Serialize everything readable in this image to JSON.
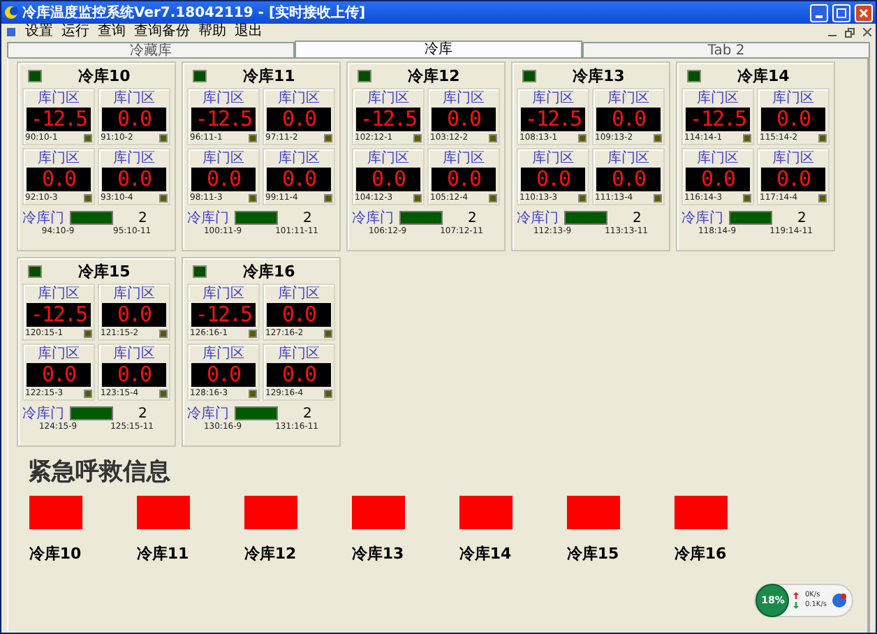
{
  "window": {
    "title": "冷库温度监控系统Ver7.18042119 - [实时接收上传]"
  },
  "menu": [
    "设置",
    "运行",
    "查询",
    "查询备份",
    "帮助",
    "退出"
  ],
  "tabs": [
    {
      "label": "冷藏库",
      "selected": false
    },
    {
      "label": "冷库",
      "selected": true
    },
    {
      "label": "Tab 2",
      "selected": false
    }
  ],
  "cards": [
    {
      "name": "冷库10",
      "zones": [
        {
          "label": "库门区",
          "value": "-12.5",
          "code": "90:10-1"
        },
        {
          "label": "库门区",
          "value": "0.0",
          "code": "91:10-2"
        },
        {
          "label": "库门区",
          "value": "0.0",
          "code": "92:10-3"
        },
        {
          "label": "库门区",
          "value": "0.0",
          "code": "93:10-4"
        }
      ],
      "door": {
        "label": "冷库门",
        "count": "2",
        "codes": [
          "94:10-9",
          "95:10-11"
        ]
      }
    },
    {
      "name": "冷库11",
      "zones": [
        {
          "label": "库门区",
          "value": "-12.5",
          "code": "96:11-1"
        },
        {
          "label": "库门区",
          "value": "0.0",
          "code": "97:11-2"
        },
        {
          "label": "库门区",
          "value": "0.0",
          "code": "98:11-3"
        },
        {
          "label": "库门区",
          "value": "0.0",
          "code": "99:11-4"
        }
      ],
      "door": {
        "label": "冷库门",
        "count": "2",
        "codes": [
          "100:11-9",
          "101:11-11"
        ]
      }
    },
    {
      "name": "冷库12",
      "zones": [
        {
          "label": "库门区",
          "value": "-12.5",
          "code": "102:12-1"
        },
        {
          "label": "库门区",
          "value": "0.0",
          "code": "103:12-2"
        },
        {
          "label": "库门区",
          "value": "0.0",
          "code": "104:12-3"
        },
        {
          "label": "库门区",
          "value": "0.0",
          "code": "105:12-4"
        }
      ],
      "door": {
        "label": "冷库门",
        "count": "2",
        "codes": [
          "106:12-9",
          "107:12-11"
        ]
      }
    },
    {
      "name": "冷库13",
      "zones": [
        {
          "label": "库门区",
          "value": "-12.5",
          "code": "108:13-1"
        },
        {
          "label": "库门区",
          "value": "0.0",
          "code": "109:13-2"
        },
        {
          "label": "库门区",
          "value": "0.0",
          "code": "110:13-3"
        },
        {
          "label": "库门区",
          "value": "0.0",
          "code": "111:13-4"
        }
      ],
      "door": {
        "label": "冷库门",
        "count": "2",
        "codes": [
          "112:13-9",
          "113:13-11"
        ]
      }
    },
    {
      "name": "冷库14",
      "zones": [
        {
          "label": "库门区",
          "value": "-12.5",
          "code": "114:14-1"
        },
        {
          "label": "库门区",
          "value": "0.0",
          "code": "115:14-2"
        },
        {
          "label": "库门区",
          "value": "0.0",
          "code": "116:14-3"
        },
        {
          "label": "库门区",
          "value": "0.0",
          "code": "117:14-4"
        }
      ],
      "door": {
        "label": "冷库门",
        "count": "2",
        "codes": [
          "118:14-9",
          "119:14-11"
        ]
      }
    },
    {
      "name": "冷库15",
      "zones": [
        {
          "label": "库门区",
          "value": "-12.5",
          "code": "120:15-1"
        },
        {
          "label": "库门区",
          "value": "0.0",
          "code": "121:15-2"
        },
        {
          "label": "库门区",
          "value": "0.0",
          "code": "122:15-3"
        },
        {
          "label": "库门区",
          "value": "0.0",
          "code": "123:15-4"
        }
      ],
      "door": {
        "label": "冷库门",
        "count": "2",
        "codes": [
          "124:15-9",
          "125:15-11"
        ]
      }
    },
    {
      "name": "冷库16",
      "zones": [
        {
          "label": "库门区",
          "value": "-12.5",
          "code": "126:16-1"
        },
        {
          "label": "库门区",
          "value": "0.0",
          "code": "127:16-2"
        },
        {
          "label": "库门区",
          "value": "0.0",
          "code": "128:16-3"
        },
        {
          "label": "库门区",
          "value": "0.0",
          "code": "129:16-4"
        }
      ],
      "door": {
        "label": "冷库门",
        "count": "2",
        "codes": [
          "130:16-9",
          "131:16-11"
        ]
      }
    }
  ],
  "emergency": {
    "title": "紧急呼救信息",
    "alarms": [
      {
        "name": "冷库10"
      },
      {
        "name": "冷库11"
      },
      {
        "name": "冷库12"
      },
      {
        "name": "冷库13"
      },
      {
        "name": "冷库14"
      },
      {
        "name": "冷库15"
      },
      {
        "name": "冷库16"
      }
    ]
  },
  "net_widget": {
    "percent": "18%",
    "upload": "0K/s",
    "download": "0.1K/s"
  }
}
